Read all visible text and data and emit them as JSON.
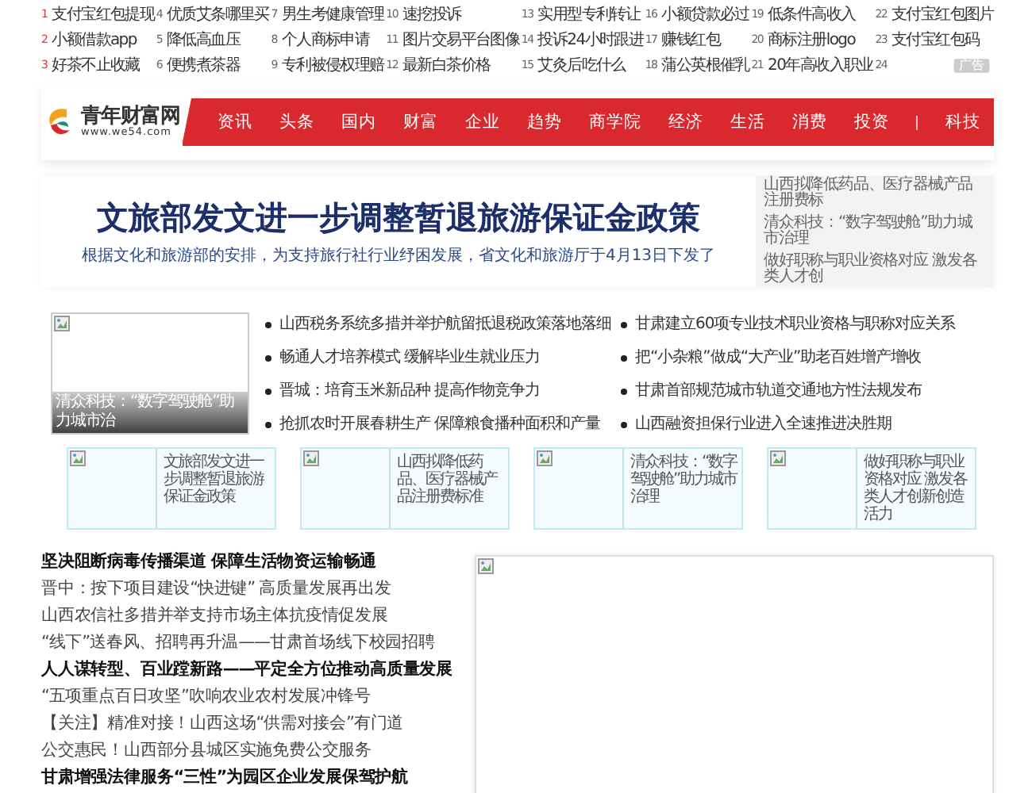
{
  "top_links": [
    {
      "num": "1",
      "text": "支付宝红包提现",
      "hot": true
    },
    {
      "num": "2",
      "text": "小额借款app",
      "hot": true
    },
    {
      "num": "3",
      "text": "好茶不止收藏",
      "hot": true
    },
    {
      "num": "4",
      "text": "优质艾条哪里买",
      "hot": false
    },
    {
      "num": "5",
      "text": "降低高血压",
      "hot": false
    },
    {
      "num": "6",
      "text": "便携煮茶器",
      "hot": false
    },
    {
      "num": "7",
      "text": "男生考健康管理",
      "hot": false
    },
    {
      "num": "8",
      "text": "个人商标申请",
      "hot": false
    },
    {
      "num": "9",
      "text": "专利被侵权理赔",
      "hot": false
    },
    {
      "num": "10",
      "text": "速挖投诉",
      "hot": false
    },
    {
      "num": "11",
      "text": "图片交易平台图像",
      "hot": false
    },
    {
      "num": "12",
      "text": "最新白茶价格",
      "hot": false
    },
    {
      "num": "13",
      "text": "实用型专利转让",
      "hot": false
    },
    {
      "num": "14",
      "text": "投诉24小时跟进",
      "hot": false
    },
    {
      "num": "15",
      "text": "艾灸后吃什么",
      "hot": false
    },
    {
      "num": "16",
      "text": "小额贷款必过",
      "hot": false
    },
    {
      "num": "17",
      "text": "赚钱红包",
      "hot": false
    },
    {
      "num": "18",
      "text": "蒲公英根催乳",
      "hot": false
    },
    {
      "num": "19",
      "text": "低条件高收入",
      "hot": false
    },
    {
      "num": "20",
      "text": "商标注册logo",
      "hot": false
    },
    {
      "num": "21",
      "text": "20年高收入职业",
      "hot": false
    },
    {
      "num": "22",
      "text": "支付宝红包图片",
      "hot": false
    },
    {
      "num": "23",
      "text": "支付宝红包码",
      "hot": false
    },
    {
      "num": "24",
      "hot": false
    }
  ],
  "ad_badge": "广告",
  "logo": {
    "name": "青年财富网",
    "url": "www.we54.com"
  },
  "nav": [
    {
      "label": "资讯"
    },
    {
      "label": "头条"
    },
    {
      "label": "国内"
    },
    {
      "label": "财富"
    },
    {
      "label": "企业"
    },
    {
      "label": "趋势"
    },
    {
      "label": "商学院"
    },
    {
      "label": "经济"
    },
    {
      "label": "生活"
    },
    {
      "label": "消费"
    },
    {
      "label": "投资"
    },
    {
      "label": "科技",
      "separated": true
    }
  ],
  "banner": {
    "title": "文旅部发文进一步调整暂退旅游保证金政策",
    "subtitle": "根据文化和旅游部的安排，为支持旅行社行业纾困发展，省文化和旅游厅于4月13日下发了",
    "side_links": [
      "山西拟降低药品、医疗器械产品注册费标",
      "清众科技：“数字驾驶舱”助力城市治理",
      "做好职称与职业资格对应 激发各类人才创"
    ]
  },
  "featured": {
    "caption": "清众科技：“数字驾驶舱”助力城市治"
  },
  "news_columns": [
    [
      "山西税务系统多措并举护航留抵退税政策落地落细",
      "畅通人才培养模式 缓解毕业生就业压力",
      "晋城：培育玉米新品种 提高作物竞争力",
      "抢抓农时开展春耕生产 保障粮食播种面积和产量"
    ],
    [
      "甘肃建立60项专业技术职业资格与职称对应关系",
      "把“小杂粮”做成“大产业”助老百姓增产增收",
      "甘肃首部规范城市轨道交通地方性法规发布",
      "山西融资担保行业进入全速推进决胜期"
    ]
  ],
  "cards": [
    "文旅部发文进一步调整暂退旅游保证金政策",
    "山西拟降低药品、医疗器械产品注册费标准",
    "清众科技：“数字驾驶舱”助力城市治理",
    "做好职称与职业资格对应 激发各类人才创新创造活力"
  ],
  "headlines": [
    {
      "text": "坚决阻断病毒传播渠道 保障生活物资运输畅通",
      "kind": "bold"
    },
    {
      "text": "晋中：按下项目建设“快进键” 高质量发展再出发",
      "kind": "plain"
    },
    {
      "text": "山西农信社多措并举支持市场主体抗疫情促发展",
      "kind": "plain"
    },
    {
      "text": "“线下”送春风、招聘再升温——甘肃首场线下校园招聘",
      "kind": "plain"
    },
    {
      "text": "人人谋转型、百业蹚新路——平定全方位推动高质量发展",
      "kind": "bold"
    },
    {
      "text": "“五项重点百日攻坚”吹响农业农村发展冲锋号",
      "kind": "plain"
    },
    {
      "text": "【关注】精准对接！山西这场“供需对接会”有门道",
      "kind": "plain"
    },
    {
      "text": "公交惠民！山西部分县城区实施免费公交服务",
      "kind": "plain"
    },
    {
      "text": "甘肃增强法律服务“三性”为园区企业发展保驾护航",
      "kind": "bold"
    }
  ]
}
